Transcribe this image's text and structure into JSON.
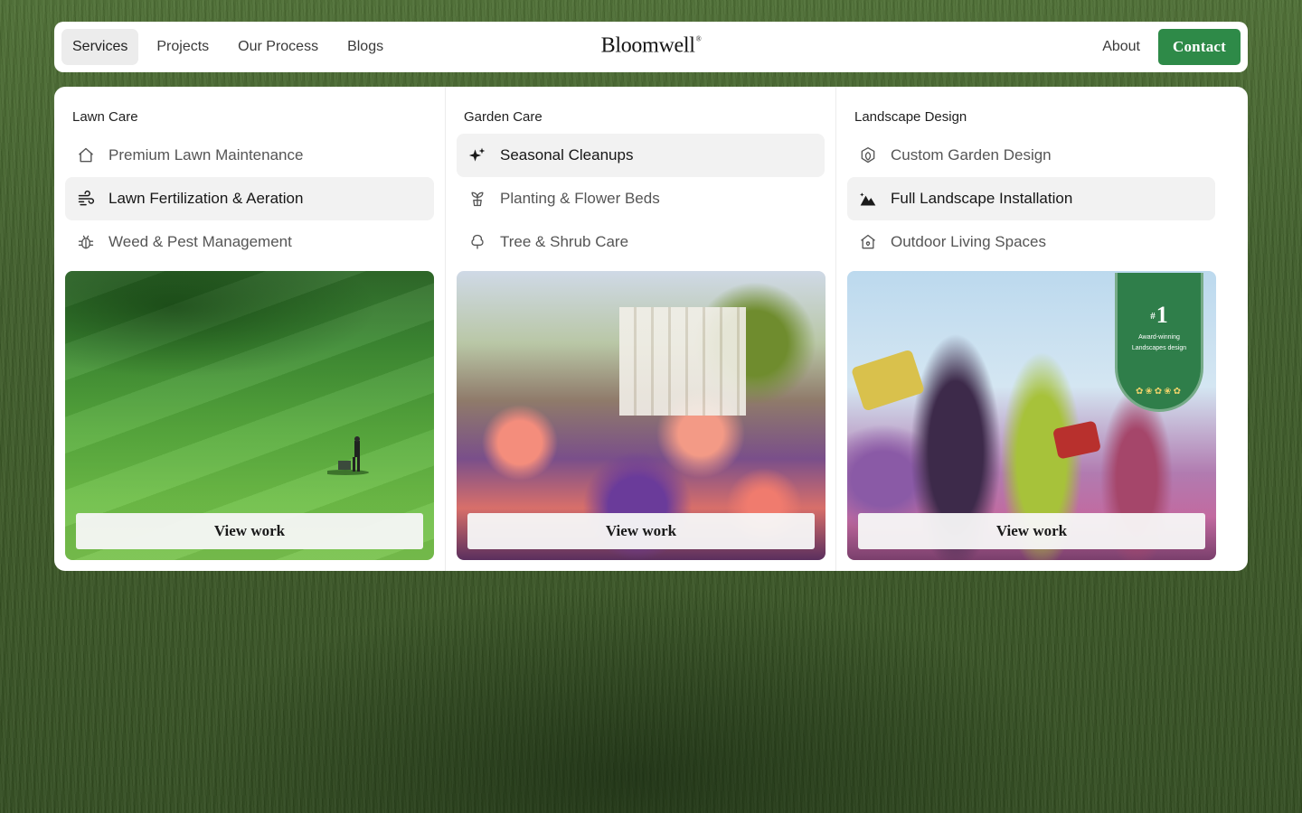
{
  "nav": {
    "links": [
      "Services",
      "Projects",
      "Our Process",
      "Blogs"
    ],
    "active_index": 0,
    "logo": "Bloomwell",
    "logo_mark": "®",
    "about": "About",
    "contact": "Contact"
  },
  "columns": [
    {
      "title": "Lawn Care",
      "items": [
        {
          "label": "Premium Lawn Maintenance",
          "icon": "house-icon"
        },
        {
          "label": "Lawn Fertilization & Aeration",
          "icon": "wind-icon"
        },
        {
          "label": "Weed & Pest Management",
          "icon": "bug-icon"
        }
      ],
      "active_index": 1,
      "card_button": "View work"
    },
    {
      "title": "Garden Care",
      "items": [
        {
          "label": "Seasonal Cleanups",
          "icon": "sparkles-icon"
        },
        {
          "label": "Planting & Flower Beds",
          "icon": "sprout-icon"
        },
        {
          "label": "Tree & Shrub Care",
          "icon": "tree-icon"
        }
      ],
      "active_index": 0,
      "card_button": "View work"
    },
    {
      "title": "Landscape Design",
      "items": [
        {
          "label": "Custom Garden Design",
          "icon": "hexagon-flower-icon"
        },
        {
          "label": "Full Landscape Installation",
          "icon": "mountain-icon"
        },
        {
          "label": "Outdoor Living Spaces",
          "icon": "home-outline-icon"
        }
      ],
      "active_index": 1,
      "card_button": "View work"
    }
  ],
  "badge": {
    "hash": "#",
    "number": "1",
    "line1": "Award-winning",
    "line2": "Landscapes design"
  },
  "colors": {
    "accent": "#2e8a48",
    "menu_bg": "#ffffff",
    "active_item_bg": "#f2f2f2"
  }
}
